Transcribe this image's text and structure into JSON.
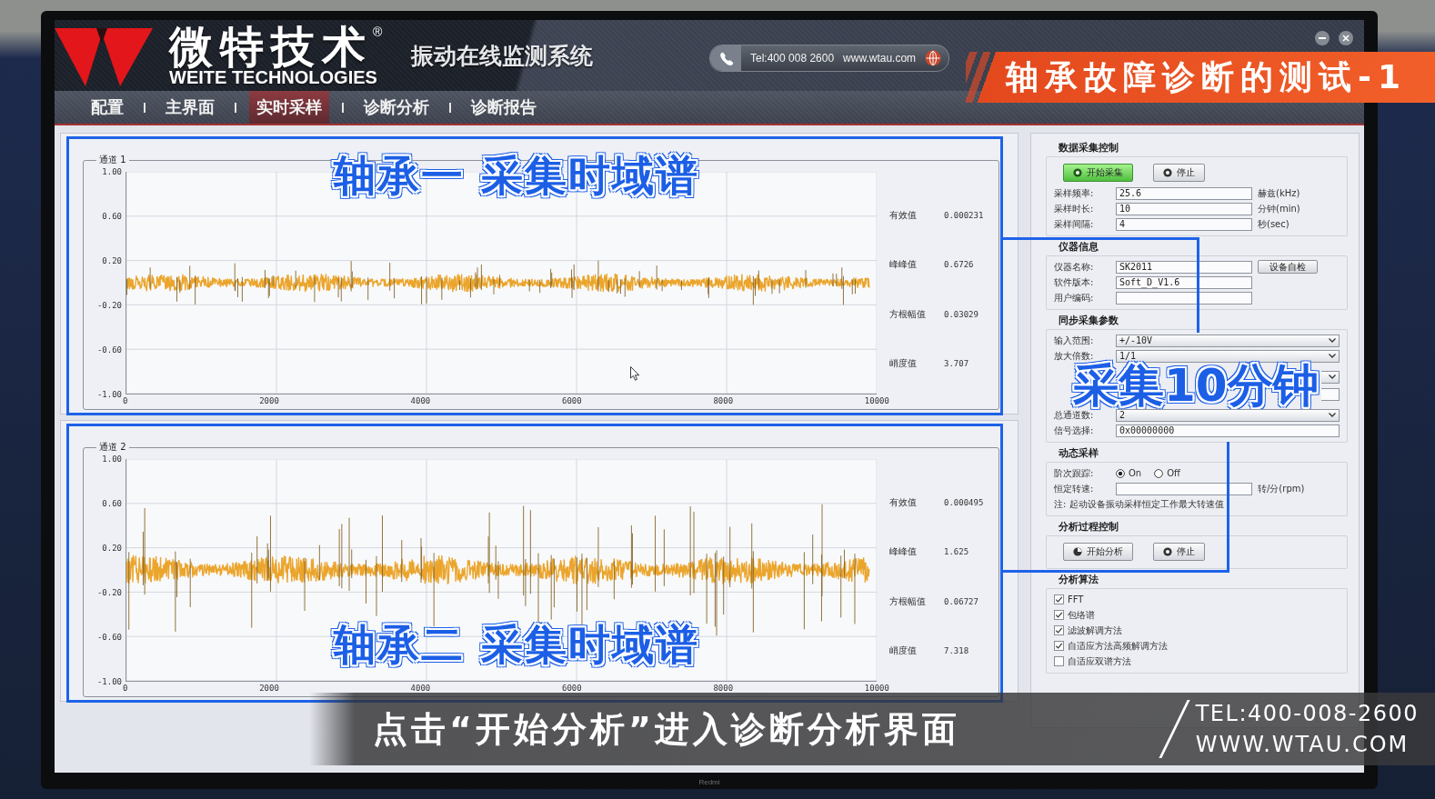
{
  "header": {
    "system_title": "振动在线监测系统",
    "tel": "Tel:400 008 2600",
    "website": "www.wtau.com"
  },
  "nav": {
    "tabs": [
      {
        "label": "配置",
        "selected": false
      },
      {
        "label": "主界面",
        "selected": false
      },
      {
        "label": "实时采样",
        "selected": true
      },
      {
        "label": "诊断分析",
        "selected": false
      },
      {
        "label": "诊断报告",
        "selected": false
      }
    ]
  },
  "charts": [
    {
      "title": "通道 1",
      "callout": "轴承一 采集时域谱",
      "y_ticks": [
        "1.00",
        "0.60",
        "0.20",
        "-0.20",
        "-0.60",
        "-1.00"
      ],
      "x_ticks": [
        "0",
        "2000",
        "4000",
        "6000",
        "8000",
        "10000"
      ],
      "stats": [
        {
          "label": "有效值",
          "value": "0.000231"
        },
        {
          "label": "峰峰值",
          "value": "0.6726"
        },
        {
          "label": "方根幅值",
          "value": "0.03029"
        },
        {
          "label": "峭度值",
          "value": "3.707"
        }
      ]
    },
    {
      "title": "通道 2",
      "callout": "轴承二 采集时域谱",
      "y_ticks": [
        "1.00",
        "0.60",
        "0.20",
        "-0.20",
        "-0.60",
        "-1.00"
      ],
      "x_ticks": [
        "0",
        "2000",
        "4000",
        "6000",
        "8000",
        "10000"
      ],
      "stats": [
        {
          "label": "有效值",
          "value": "0.000495"
        },
        {
          "label": "峰峰值",
          "value": "1.625"
        },
        {
          "label": "方根幅值",
          "value": "0.06727"
        },
        {
          "label": "峭度值",
          "value": "7.318"
        }
      ]
    }
  ],
  "control_panel": {
    "groups": [
      {
        "title": "数据采集控制",
        "buttons": [
          {
            "label": "开始采集",
            "kind": "start",
            "highlighted": true
          },
          {
            "label": "停止",
            "kind": "stop",
            "highlighted": false
          }
        ],
        "rows": [
          {
            "kind": "text",
            "label": "采样频率:",
            "value": "25.6",
            "unit": "赫兹(kHz)"
          },
          {
            "kind": "text",
            "label": "采样时长:",
            "value": "10",
            "unit": "分钟(min)"
          },
          {
            "kind": "text",
            "label": "采样间隔:",
            "value": "4",
            "unit": "秒(sec)"
          }
        ]
      },
      {
        "title": "仪器信息",
        "rows": [
          {
            "kind": "text",
            "label": "仪器名称:",
            "value": "SK2011",
            "action": "设备自检"
          },
          {
            "kind": "text",
            "label": "软件版本:",
            "value": "Soft_D_V1.6"
          },
          {
            "kind": "text",
            "label": "用户编码:"
          }
        ]
      },
      {
        "title": "同步采集参数",
        "rows": [
          {
            "kind": "select",
            "label": "输入范围:",
            "value": "+/-10V"
          },
          {
            "kind": "select",
            "label": "放大倍数:",
            "value": "1/1"
          },
          {
            "kind": "callout",
            "text": "采集10分钟",
            "covered_rows": [
              {
                "kind": "select"
              },
              {
                "kind": "text"
              }
            ]
          },
          {
            "kind": "select",
            "label": "总通道数:",
            "value": "2"
          },
          {
            "kind": "text",
            "label": "信号选择:",
            "value": "0x00000000"
          }
        ]
      },
      {
        "title": "动态采样",
        "rows": [
          {
            "kind": "radio",
            "label": "阶次跟踪:",
            "options": [
              {
                "label": "On",
                "selected": true
              },
              {
                "label": "Off",
                "selected": false
              }
            ]
          },
          {
            "kind": "text",
            "label": "恒定转速:",
            "unit": "转/分(rpm)"
          },
          {
            "kind": "note",
            "text": "注: 起动设备振动采样恒定工作最大转速值"
          }
        ]
      },
      {
        "title": "分析过程控制",
        "buttons": [
          {
            "label": "开始分析",
            "kind": "analyze",
            "highlighted": false
          },
          {
            "label": "停止",
            "kind": "stop",
            "highlighted": false
          }
        ]
      },
      {
        "title": "分析算法",
        "checkboxes": [
          {
            "label": "FFT",
            "checked": true
          },
          {
            "label": "包络谱",
            "checked": true
          },
          {
            "label": "滤波解调方法",
            "checked": true
          },
          {
            "label": "自适应方法高频解调方法",
            "checked": true
          },
          {
            "label": "自适应双谱方法",
            "checked": false
          }
        ]
      }
    ]
  },
  "video_overlay": {
    "logo": {
      "name": "微特技术",
      "mark": "®",
      "subtitle": "WEITE TECHNOLOGIES"
    },
    "banner": "轴承故障诊断的测试-1",
    "caption": "点击“开始分析”进入诊断分析界面",
    "contact": [
      "TEL:400-008-2600",
      "WWW.WTAU.COM"
    ]
  },
  "monitor": {
    "brand": "Redmi"
  }
}
